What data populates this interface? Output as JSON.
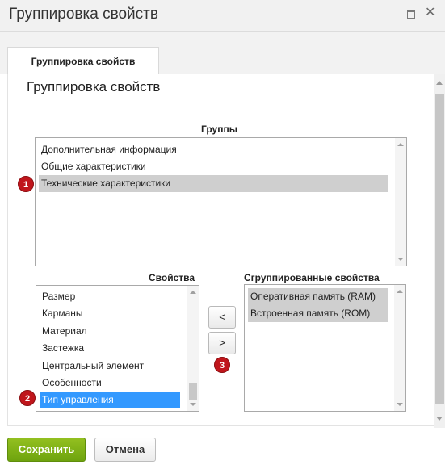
{
  "window": {
    "title": "Группировка свойств",
    "tab_label": "Группировка свойств",
    "panel_title": "Группировка свойств"
  },
  "groups": {
    "label": "Группы",
    "items": [
      "Дополнительная информация",
      "Общие характеристики",
      "Технические характеристики"
    ],
    "selected": "Технические характеристики"
  },
  "properties": {
    "label": "Свойства",
    "items": [
      "Размер",
      "Карманы",
      "Материал",
      "Застежка",
      "Центральный элемент",
      "Особенности",
      "Тип управления"
    ],
    "selected": "Тип управления"
  },
  "grouped": {
    "label": "Сгруппированные свойства",
    "items": [
      "Оперативная память (RAM)",
      "Встроенная память (ROM)"
    ]
  },
  "move_buttons": {
    "left": "<",
    "right": ">"
  },
  "badges": [
    "1",
    "2",
    "3"
  ],
  "footer": {
    "save": "Сохранить",
    "cancel": "Отмена"
  },
  "colors": {
    "save_green": "#7cb014",
    "badge_red": "#c0161c",
    "selection_blue": "#3399ff",
    "selection_gray": "#cfcfcf"
  },
  "icons": [
    "maximize-icon",
    "close-icon"
  ]
}
